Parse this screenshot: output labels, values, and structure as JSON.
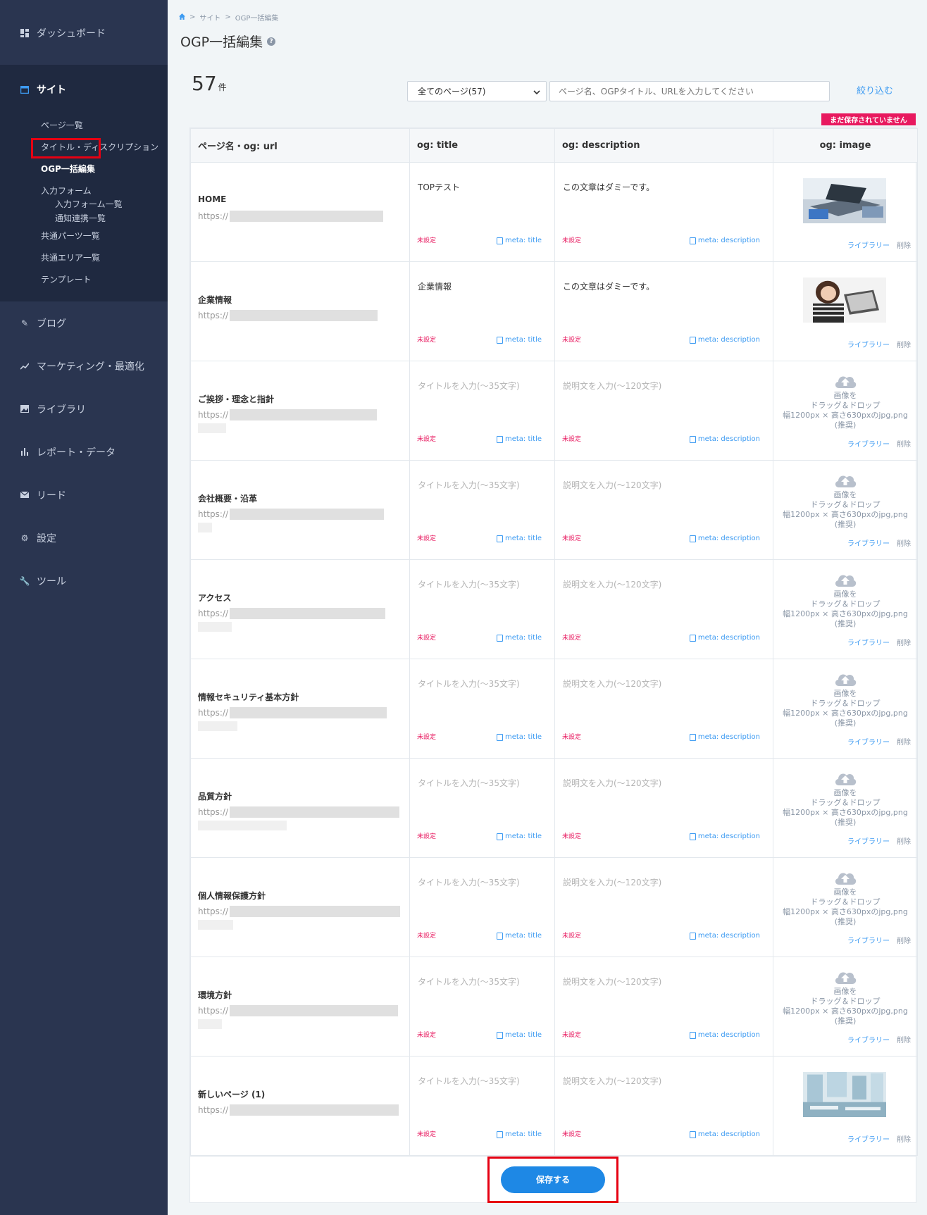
{
  "sidebar": {
    "dashboard": "ダッシュボード",
    "site": "サイト",
    "site_items": {
      "pages": "ページ一覧",
      "title_desc": "タイトル・ディスクリプション",
      "ogp": "OGP一括編集",
      "forms": "入力フォーム",
      "forms_list": "入力フォーム一覧",
      "notify": "通知連携一覧",
      "parts": "共通パーツ一覧",
      "areas": "共通エリア一覧",
      "templates": "テンプレート"
    },
    "blog": "ブログ",
    "marketing": "マーケティング・最適化",
    "library": "ライブラリ",
    "report": "レポート・データ",
    "lead": "リード",
    "settings": "設定",
    "tools": "ツール"
  },
  "breadcrumb": {
    "site": "サイト",
    "current": "OGP一括編集",
    "sep": ">"
  },
  "page_title": "OGP一括編集",
  "count": {
    "value": "57",
    "unit": "件"
  },
  "filter": {
    "select_value": "全てのページ(57)",
    "search_placeholder": "ページ名、OGPタイトル、URLを入力してください",
    "button": "絞り込む"
  },
  "unsaved_badge": "まだ保存されていません",
  "table": {
    "headers": [
      "ページ名・og: url",
      "og: title",
      "og: description",
      "og: image"
    ],
    "rows": [
      {
        "name": "HOME",
        "title": "TOPテスト",
        "desc": "この文章はダミーです。"
      },
      {
        "name": "企業情報",
        "title": "企業情報",
        "desc": "この文章はダミーです。"
      },
      {
        "name": "ご挨拶・理念と指針",
        "title": "",
        "desc": ""
      },
      {
        "name": "会社概要・沿革",
        "title": "",
        "desc": ""
      },
      {
        "name": "アクセス",
        "title": "",
        "desc": ""
      },
      {
        "name": "情報セキュリティ基本方針",
        "title": "",
        "desc": ""
      },
      {
        "name": "品質方針",
        "title": "",
        "desc": ""
      },
      {
        "name": "個人情報保護方針",
        "title": "",
        "desc": ""
      },
      {
        "name": "環境方針",
        "title": "",
        "desc": ""
      },
      {
        "name": "新しいページ (1)",
        "title": "",
        "desc": ""
      }
    ],
    "url_prefix": "https://",
    "title_placeholder": "タイトルを入力(〜35文字)",
    "desc_placeholder": "説明文を入力(〜120文字)",
    "unset": "未設定",
    "meta_title": "meta: title",
    "meta_description": "meta: description",
    "upload_line1": "画像を",
    "upload_line2": "ドラッグ＆ドロップ",
    "upload_line3": "幅1200px × 高さ630pxのjpg,png",
    "upload_line4": "(推奨)",
    "library": "ライブラリー",
    "delete": "削除"
  },
  "save_button": "保存する",
  "colors": {
    "sidebar": "#2a3550",
    "accent": "#3d9bf2",
    "danger": "#e8195f",
    "save": "#1e88e5",
    "highlight": "#e60012"
  }
}
